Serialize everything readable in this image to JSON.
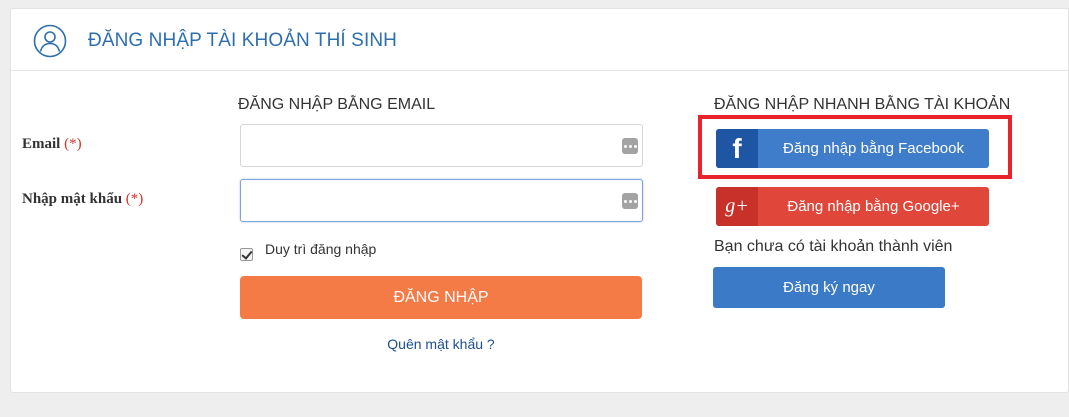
{
  "header": {
    "title": "ĐĂNG NHẬP TÀI KHOẢN THÍ SINH",
    "icon": "user-circle-icon"
  },
  "email_section": {
    "title": "ĐĂNG NHẬP BẰNG EMAIL",
    "email_label": "Email",
    "password_label": "Nhập mật khẩu",
    "required_mark": "(*)",
    "email_value": "",
    "password_value": "",
    "remember_label": "Duy trì đăng nhập",
    "remember_checked": true,
    "login_label": "ĐĂNG NHẬP",
    "forgot_label": "Quên mật khẩu ?"
  },
  "quick_section": {
    "title": "ĐĂNG NHẬP NHANH BẰNG TÀI KHOẢN",
    "facebook": {
      "icon_text": "f",
      "label": "Đăng nhập bằng Facebook",
      "color": "#3f7cc9"
    },
    "google": {
      "icon_text": "g+",
      "label": "Đăng nhập bằng Google+",
      "color": "#e1463a"
    },
    "no_account_text": "Bạn chưa có tài khoản thành viên",
    "register_label": "Đăng ký ngay"
  },
  "colors": {
    "title_blue": "#2d6fae",
    "login_orange": "#f47a46",
    "highlight_red": "#e8232a",
    "register_blue": "#3a7ac7"
  }
}
